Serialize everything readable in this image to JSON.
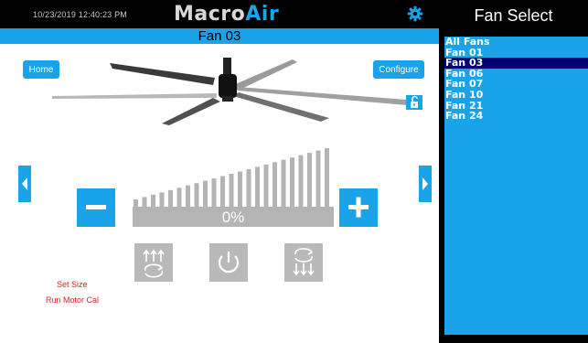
{
  "header": {
    "timestamp": "10/23/2019 12:40:23 PM",
    "logo_main": "Macro",
    "logo_accent": "Air",
    "fan_title": "Fan 03"
  },
  "nav": {
    "home_label": "Home",
    "configure_label": "Configure"
  },
  "speed": {
    "value_text": "0%",
    "level": 0
  },
  "links": {
    "set_size": "Set Size",
    "run_motor_cal": "Run Motor Cal"
  },
  "fan_select": {
    "title": "Fan Select",
    "items": [
      "All Fans",
      "Fan 01",
      "Fan 03",
      "Fan 06",
      "Fan 07",
      "Fan 10",
      "Fan 21",
      "Fan 24"
    ],
    "selected": "Fan 03"
  },
  "colors": {
    "accent": "#1aa3e8",
    "selected_bg": "#000070",
    "link_red": "#e02020",
    "disabled_gray": "#b9b9b9"
  },
  "icons": [
    "gear-icon",
    "unlock-icon",
    "left-arrow-icon",
    "right-arrow-icon",
    "minus-icon",
    "plus-icon",
    "forward-direction-icon",
    "power-icon",
    "reverse-direction-icon"
  ]
}
